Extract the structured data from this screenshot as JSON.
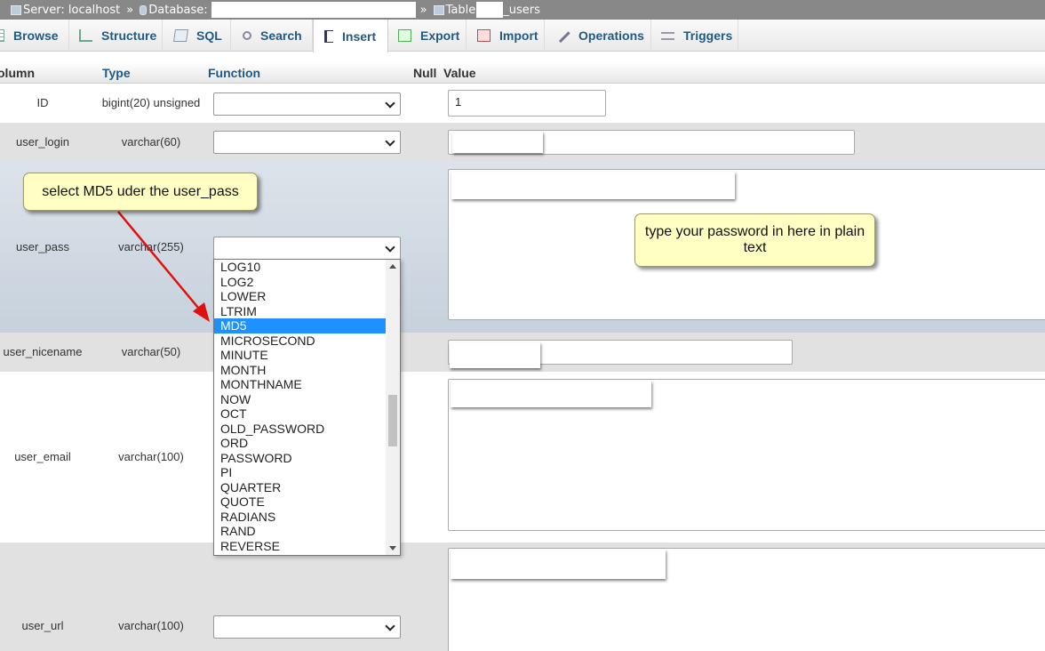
{
  "breadcrumb": {
    "server": "Server: localhost",
    "sep": "»",
    "database": "Database:",
    "table": "Table",
    "table_suffix": "_users"
  },
  "tabs": [
    {
      "label": "Browse",
      "icon": "browse-icon"
    },
    {
      "label": "Structure",
      "icon": "structure-icon"
    },
    {
      "label": "SQL",
      "icon": "sql-icon"
    },
    {
      "label": "Search",
      "icon": "search-icon"
    },
    {
      "label": "Insert",
      "icon": "insert-icon",
      "active": true
    },
    {
      "label": "Export",
      "icon": "export-icon"
    },
    {
      "label": "Import",
      "icon": "import-icon"
    },
    {
      "label": "Operations",
      "icon": "wrench-icon"
    },
    {
      "label": "Triggers",
      "icon": "triggers-icon"
    }
  ],
  "header": {
    "column": "olumn",
    "type": "Type",
    "function": "Function",
    "null": "Null",
    "value": "Value"
  },
  "rows": [
    {
      "name": "ID",
      "type": "bigint(20) unsigned",
      "value": "1"
    },
    {
      "name": "user_login",
      "type": "varchar(60)",
      "value": ""
    },
    {
      "name": "user_pass",
      "type": "varchar(255)",
      "value": ""
    },
    {
      "name": "user_nicename",
      "type": "varchar(50)",
      "value": ""
    },
    {
      "name": "user_email",
      "type": "varchar(100)",
      "value": ""
    },
    {
      "name": "user_url",
      "type": "varchar(100)",
      "value": ""
    }
  ],
  "dropdown": {
    "options": [
      "LOG10",
      "LOG2",
      "LOWER",
      "LTRIM",
      "MD5",
      "MICROSECOND",
      "MINUTE",
      "MONTH",
      "MONTHNAME",
      "NOW",
      "OCT",
      "OLD_PASSWORD",
      "ORD",
      "PASSWORD",
      "PI",
      "QUARTER",
      "QUOTE",
      "RADIANS",
      "RAND",
      "REVERSE"
    ],
    "selected": "MD5"
  },
  "annotations": {
    "callout_md5": "select MD5 uder the user_pass",
    "callout_password": "type your password in here in plain text"
  },
  "colors": {
    "tab_text": "#235a81",
    "selected_option": "#1e90ff",
    "callout_bg": "#ffffc4",
    "arrow": "#e01010"
  }
}
